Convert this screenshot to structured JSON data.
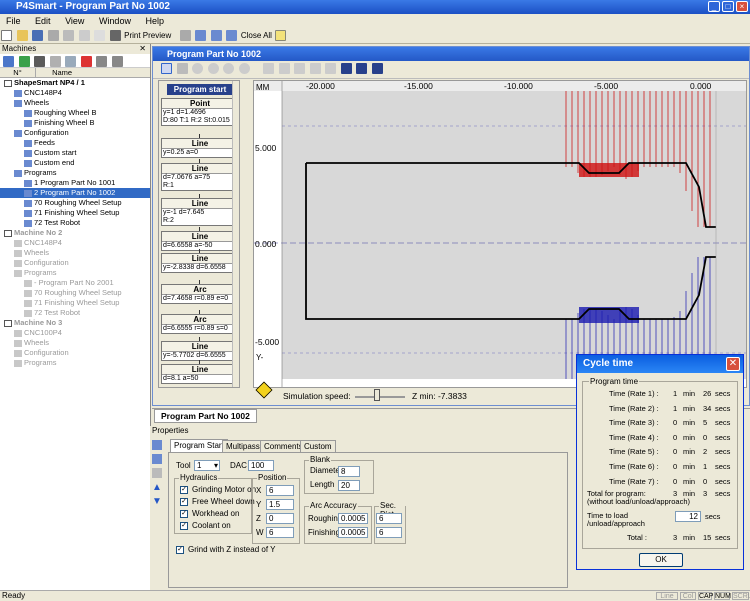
{
  "app": {
    "title": "P4Smart - Program Part No 1002"
  },
  "menu": [
    "File",
    "Edit",
    "View",
    "Window",
    "Help"
  ],
  "toolbar": {
    "print_preview": "Print Preview",
    "close_all": "Close All"
  },
  "machines_panel": {
    "title": "Machines",
    "headers": [
      "N°",
      "Name"
    ],
    "rows": [
      {
        "text": "ShapeSmart NP4 / 1",
        "level": 0,
        "bold": true,
        "state": "normal"
      },
      {
        "text": "CNC148P4",
        "level": 1,
        "state": "normal"
      },
      {
        "text": "Wheels",
        "level": 1,
        "state": "normal"
      },
      {
        "text": "Roughing Wheel B",
        "level": 2,
        "state": "normal"
      },
      {
        "text": "Finishing Wheel B",
        "level": 2,
        "state": "normal"
      },
      {
        "text": "Configuration",
        "level": 1,
        "state": "normal"
      },
      {
        "text": "Feeds",
        "level": 2,
        "state": "normal"
      },
      {
        "text": "Custom start",
        "level": 2,
        "state": "normal"
      },
      {
        "text": "Custom end",
        "level": 2,
        "state": "normal"
      },
      {
        "text": "Programs",
        "level": 1,
        "state": "normal"
      },
      {
        "text": "1     Program Part No 1001",
        "level": 2,
        "state": "normal"
      },
      {
        "text": "2     Program Part No 1002",
        "level": 2,
        "state": "selected"
      },
      {
        "text": "70   Roughing Wheel Setup",
        "level": 2,
        "state": "normal"
      },
      {
        "text": "71   Finishing Wheel Setup",
        "level": 2,
        "state": "normal"
      },
      {
        "text": "72   Test Robot",
        "level": 2,
        "state": "normal"
      },
      {
        "text": "Machine No 2",
        "level": 0,
        "bold": true,
        "state": "gray"
      },
      {
        "text": "CNC148P4",
        "level": 1,
        "state": "gray"
      },
      {
        "text": "Wheels",
        "level": 1,
        "state": "gray"
      },
      {
        "text": "Configuration",
        "level": 1,
        "state": "gray"
      },
      {
        "text": "Programs",
        "level": 1,
        "state": "gray"
      },
      {
        "text": "-     Program Part No 2001",
        "level": 2,
        "state": "gray"
      },
      {
        "text": "70   Roughing Wheel Setup",
        "level": 2,
        "state": "gray"
      },
      {
        "text": "71   Finishing Wheel Setup",
        "level": 2,
        "state": "gray"
      },
      {
        "text": "72   Test Robot",
        "level": 2,
        "state": "gray"
      },
      {
        "text": "Machine No 3",
        "level": 0,
        "bold": true,
        "state": "gray"
      },
      {
        "text": "CNC100P4",
        "level": 1,
        "state": "gray"
      },
      {
        "text": "Wheels",
        "level": 1,
        "state": "gray"
      },
      {
        "text": "Configuration",
        "level": 1,
        "state": "gray"
      },
      {
        "text": "Programs",
        "level": 1,
        "state": "gray"
      }
    ]
  },
  "doc": {
    "title": "Program Part No 1002"
  },
  "flow": {
    "start": "Program start",
    "blocks": [
      {
        "title": "Point",
        "lines": [
          "y=1 d=1.4696",
          "D:80 T:1 R:2 St:0.015"
        ]
      },
      {
        "title": "Line",
        "lines": [
          "y=0.25 a=0"
        ]
      },
      {
        "title": "Line",
        "lines": [
          "d=7.0676 a=75",
          "R:1"
        ]
      },
      {
        "title": "Line",
        "lines": [
          "y=-1 d=7.645",
          "R:2"
        ]
      },
      {
        "title": "Line",
        "lines": [
          "d=6.6558 a=-50"
        ]
      },
      {
        "title": "Line",
        "lines": [
          "y=-2.8338 d=6.6558"
        ]
      },
      {
        "title": "Arc",
        "lines": [
          "d=7.4658 r=0.89 e=0"
        ]
      },
      {
        "title": "Arc",
        "lines": [
          "d=6.6555 r=0.89 s=0"
        ]
      },
      {
        "title": "Line",
        "lines": [
          "y=-5.7702 d=6.6555"
        ]
      },
      {
        "title": "Line",
        "lines": [
          "d=8.1 a=50"
        ]
      }
    ]
  },
  "canvas": {
    "unit": "MM",
    "x_ticks": [
      "-20.000",
      "-15.000",
      "-10.000",
      "-5.000",
      "0.000"
    ],
    "y_ticks": [
      "5.000",
      "0.000",
      "-5.000"
    ],
    "y_label": "Y-",
    "sim_speed_label": "Simulation speed:",
    "zmin": "Z min: -7.3833"
  },
  "bottom_tab": {
    "label": "Program Part No 1002"
  },
  "properties": {
    "title": "Properties",
    "tabs": [
      "Program Start",
      "Multipass",
      "Comments",
      "Custom"
    ],
    "tool_label": "Tool",
    "tool_value": "1",
    "dac_label": "DAC",
    "dac_value": "100",
    "hydraulics": {
      "legend": "Hydraulics",
      "items": [
        "Grinding Motor on",
        "Free Wheel down",
        "Workhead on",
        "Coolant on"
      ]
    },
    "position": {
      "legend": "Position",
      "labels": [
        "X",
        "Y",
        "Z",
        "W"
      ],
      "values": [
        "6",
        "1.5",
        "0",
        "6"
      ]
    },
    "blank": {
      "legend": "Blank",
      "diameter_label": "Diameter",
      "diameter": "8",
      "length_label": "Length",
      "length": "20"
    },
    "arc_accuracy": {
      "legend": "Arc Accuracy",
      "roughing_label": "Roughing",
      "roughing": "0.0005",
      "finishing_label": "Finishing",
      "finishing": "0.0005"
    },
    "sec_dist": {
      "legend": "Sec. Dist.",
      "roughing": "6",
      "finishing": "6"
    },
    "grind_z": "Grind with Z instead of Y"
  },
  "cycle_time": {
    "title": "Cycle time",
    "group": "Program time",
    "rows": [
      {
        "label": "Time (Rate 1) :",
        "min": "1",
        "sec": "26"
      },
      {
        "label": "Time (Rate 2) :",
        "min": "1",
        "sec": "34"
      },
      {
        "label": "Time (Rate 3) :",
        "min": "0",
        "sec": "5"
      },
      {
        "label": "Time (Rate 4) :",
        "min": "0",
        "sec": "0"
      },
      {
        "label": "Time (Rate 5) :",
        "min": "0",
        "sec": "2"
      },
      {
        "label": "Time (Rate 6) :",
        "min": "0",
        "sec": "1"
      },
      {
        "label": "Time (Rate 7) :",
        "min": "0",
        "sec": "0"
      }
    ],
    "min_unit": "min",
    "sec_unit": "secs",
    "total_program_label": "Total for program:",
    "total_program_min": "3",
    "total_program_sec": "3",
    "total_program_note": "(without load/unload/approach)",
    "load_label": "Time to load",
    "load_label2": "/unload/approach",
    "load_value": "12",
    "total_label": "Total :",
    "total_min": "3",
    "total_sec": "15",
    "ok": "OK"
  },
  "status": {
    "left": "Ready",
    "cells": [
      "Line",
      "Col",
      "CAP",
      "NUM",
      "SCRL"
    ]
  }
}
